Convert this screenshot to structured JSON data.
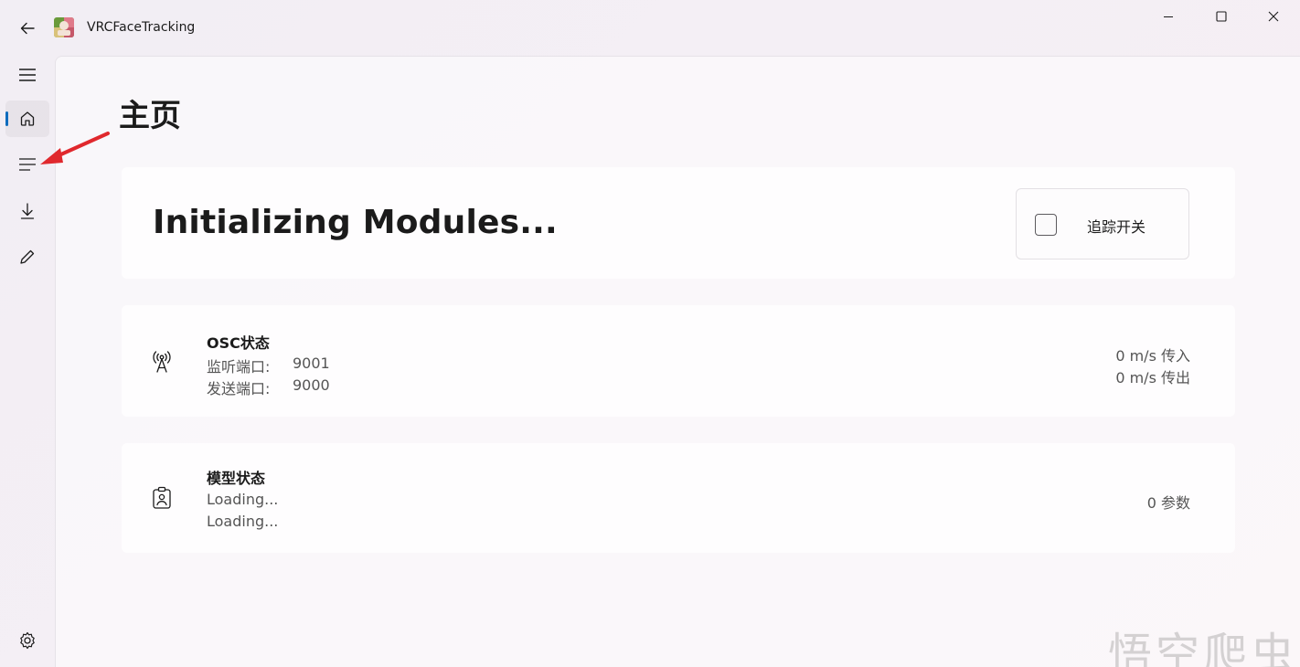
{
  "window": {
    "title": "VRCFaceTracking"
  },
  "page": {
    "title": "主页"
  },
  "status": {
    "text": "Initializing Modules...",
    "toggle_label": "追踪开关"
  },
  "osc": {
    "heading": "OSC状态",
    "listen_label": "监听端口:",
    "listen_port": "9001",
    "send_label": "发送端口:",
    "send_port": "9000",
    "in_rate": "0 m/s 传入",
    "out_rate": "0 m/s 传出"
  },
  "model": {
    "heading": "模型状态",
    "line1": "Loading...",
    "line2": "Loading...",
    "params": "0 参数"
  },
  "watermark": "悟空爬虫",
  "colors": {
    "accent": "#0f6cbd",
    "annotation_arrow": "#e0282d"
  },
  "icons": [
    "back-arrow-icon",
    "app-logo-icon",
    "minimize-icon",
    "maximize-icon",
    "close-icon",
    "hamburger-menu-icon",
    "home-icon",
    "list-icon",
    "download-icon",
    "pencil-icon",
    "settings-gear-icon",
    "antenna-icon",
    "badge-icon"
  ]
}
